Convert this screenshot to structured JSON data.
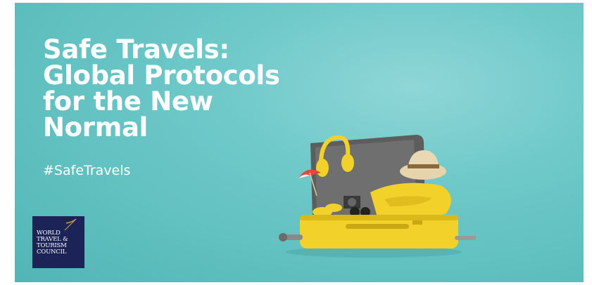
{
  "headline": {
    "line1": "Safe Travels:",
    "line2": "Global Protocols",
    "line3": "for the New",
    "line4": "Normal"
  },
  "hashtag": "#SafeTravels",
  "logo": {
    "line1": "WORLD",
    "line2": "TRAVEL &",
    "line3": "TOURISM",
    "line4": "COUNCIL"
  },
  "colors": {
    "background": "#62c2c2",
    "logo_bg": "#1c2357",
    "suitcase": "#f2d12a"
  },
  "illustration": "open-suitcase-icon"
}
